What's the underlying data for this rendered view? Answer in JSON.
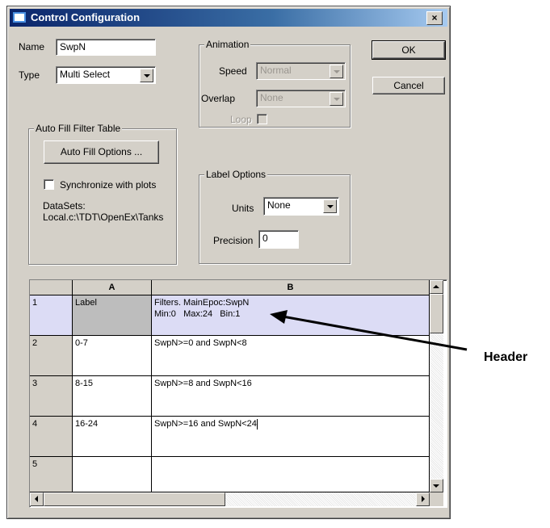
{
  "window": {
    "title": "Control Configuration",
    "close_glyph": "×"
  },
  "name": {
    "label": "Name",
    "value": "SwpN"
  },
  "type": {
    "label": "Type",
    "value": "Multi Select"
  },
  "animation": {
    "title": "Animation",
    "speed_label": "Speed",
    "speed_value": "Normal",
    "overlap_label": "Overlap",
    "overlap_value": "None",
    "loop_label": "Loop"
  },
  "buttons": {
    "ok": "OK",
    "cancel": "Cancel"
  },
  "autofill": {
    "title": "Auto Fill Filter Table",
    "options_button": "Auto Fill Options ...",
    "sync_label": "Synchronize with  plots",
    "datasets_label": "DataSets:",
    "datasets_value": "Local.c:\\TDT\\OpenEx\\Tanks"
  },
  "label_options": {
    "title": "Label Options",
    "units_label": "Units",
    "units_value": "None",
    "precision_label": "Precision",
    "precision_value": "0"
  },
  "grid": {
    "columns": [
      "A",
      "B"
    ],
    "rows": [
      {
        "num": "1",
        "a": "Label",
        "b": "Filters. MainEpoc:SwpN",
        "b2": "Min:0   Max:24   Bin:1"
      },
      {
        "num": "2",
        "a": "0-7",
        "b": "SwpN>=0 and SwpN<8"
      },
      {
        "num": "3",
        "a": "8-15",
        "b": "SwpN>=8 and SwpN<16"
      },
      {
        "num": "4",
        "a": "16-24",
        "b": "SwpN>=16 and SwpN<24"
      },
      {
        "num": "5",
        "a": "",
        "b": ""
      }
    ]
  },
  "annotation": {
    "text": "Header"
  }
}
